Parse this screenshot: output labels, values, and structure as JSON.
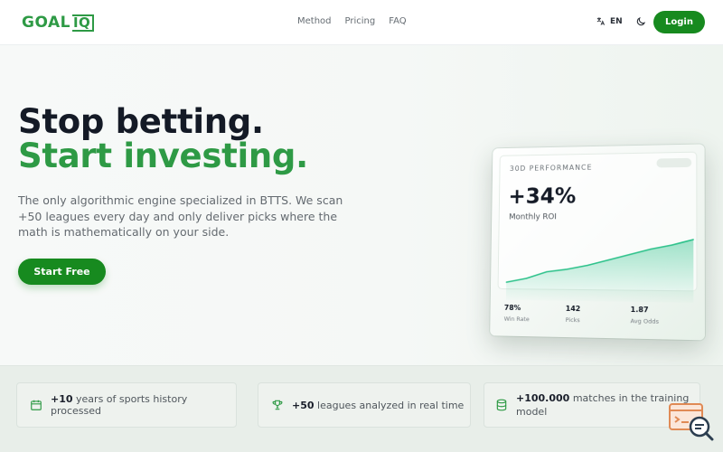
{
  "brand": {
    "logo_text": "GOAL",
    "logo_box_text": "IQ"
  },
  "nav": {
    "links": [
      "Method",
      "Pricing",
      "FAQ"
    ],
    "language": "EN",
    "login_label": "Login"
  },
  "hero": {
    "title_line1": "Stop betting.",
    "title_line2": "Start investing.",
    "description": "The only algorithmic engine specialized in BTTS. We scan +50 leagues every day and only deliver picks where the math is mathematically on your side.",
    "cta_label": "Start Free"
  },
  "performance_card": {
    "label": "30D PERFORMANCE",
    "roi_value": "+34%",
    "roi_label": "Monthly ROI",
    "stats": [
      {
        "value": "78%",
        "label": "Win Rate"
      },
      {
        "value": "142",
        "label": "Picks"
      },
      {
        "value": "1.87",
        "label": "Avg Odds"
      }
    ]
  },
  "chart_data": {
    "type": "area",
    "title": "",
    "xlabel": "",
    "ylabel": "",
    "x": [
      1,
      2,
      3,
      4,
      5,
      6,
      7,
      8,
      9,
      10
    ],
    "values": [
      0,
      3,
      8,
      10,
      13,
      17,
      21,
      25,
      28,
      32
    ],
    "ylim": [
      0,
      40
    ],
    "color": "#2ec28b",
    "grid": false
  },
  "features": [
    {
      "icon": "calendar-icon",
      "bold": "+10",
      "text": " years of sports history processed"
    },
    {
      "icon": "trophy-icon",
      "bold": "+50",
      "text": " leagues analyzed in real time"
    },
    {
      "icon": "database-icon",
      "bold": "+100.000",
      "text": " matches in the training model"
    }
  ],
  "colors": {
    "brand_green": "#178a1f",
    "accent_green": "#2e9a45",
    "chart_line": "#2ec28b"
  }
}
